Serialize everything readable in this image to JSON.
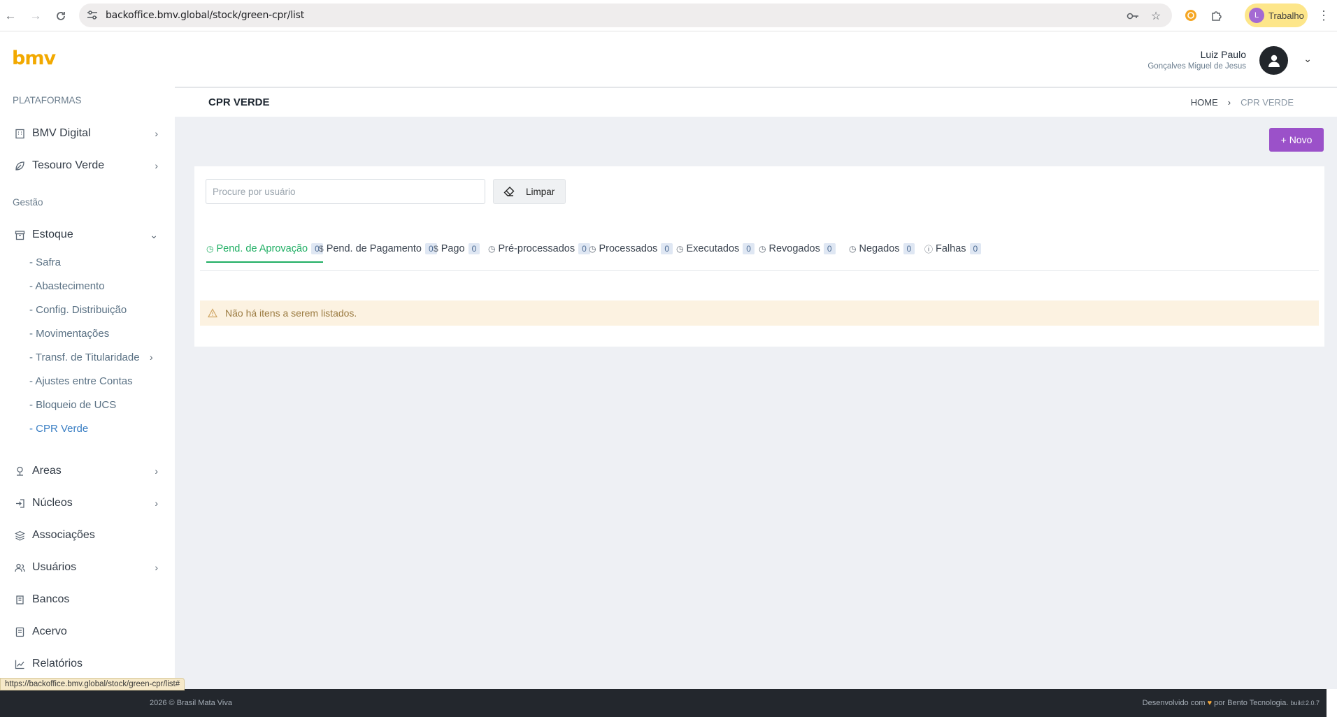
{
  "browser": {
    "url": "backoffice.bmv.global/stock/green-cpr/list",
    "profile_initial": "L",
    "profile_label": "Trabalho",
    "status_url": "https://backoffice.bmv.global/stock/green-cpr/list#"
  },
  "brand": {
    "logo_text": "bmv",
    "color": "#f2a900"
  },
  "sidebar": {
    "section_platforms": "PLATAFORMAS",
    "platforms": [
      {
        "label": "BMV Digital",
        "icon": "building-icon"
      },
      {
        "label": "Tesouro Verde",
        "icon": "leaf-icon"
      }
    ],
    "section_management": "Gestão",
    "stock": {
      "label": "Estoque",
      "icon": "archive-icon",
      "children": [
        {
          "label": "- Safra"
        },
        {
          "label": "- Abastecimento"
        },
        {
          "label": "- Config. Distribuição"
        },
        {
          "label": "- Movimentações"
        },
        {
          "label": "- Transf. de Titularidade"
        },
        {
          "label": "- Ajustes entre Contas"
        },
        {
          "label": "- Bloqueio de UCS"
        },
        {
          "label": "- CPR Verde"
        }
      ]
    },
    "items": [
      {
        "label": "Areas",
        "icon": "tree-icon"
      },
      {
        "label": "Núcleos",
        "icon": "login-icon"
      },
      {
        "label": "Associações",
        "icon": "layers-icon"
      },
      {
        "label": "Usuários",
        "icon": "users-icon"
      },
      {
        "label": "Bancos",
        "icon": "bank-icon"
      },
      {
        "label": "Acervo",
        "icon": "book-icon"
      },
      {
        "label": "Relatórios",
        "icon": "chart-icon"
      }
    ]
  },
  "user": {
    "name": "Luiz Paulo",
    "subtitle": "Gonçalves Miguel de Jesus"
  },
  "page": {
    "title": "CPR VERDE",
    "breadcrumb_home": "HOME",
    "breadcrumb_separator": "›",
    "breadcrumb_current": "CPR VERDE",
    "new_button": "+ Novo",
    "new_button_color": "#9b51c9"
  },
  "filters": {
    "search_placeholder": "Procure por usuário",
    "clear_button": "Limpar"
  },
  "tabs": [
    {
      "label": "Pend. de Aprovação",
      "count": "0",
      "icon": "clock-icon",
      "active": true
    },
    {
      "label": "Pend. de Pagamento",
      "count": "0",
      "icon": "dollar-icon"
    },
    {
      "label": "Pago",
      "count": "0",
      "icon": "dollar-icon"
    },
    {
      "label": "Pré-processados",
      "count": "0",
      "icon": "clock-icon"
    },
    {
      "label": "Processados",
      "count": "0",
      "icon": "clock-icon"
    },
    {
      "label": "Executados",
      "count": "0",
      "icon": "clock-icon"
    },
    {
      "label": "Revogados",
      "count": "0",
      "icon": "clock-icon"
    },
    {
      "label": "Negados",
      "count": "0",
      "icon": "clock-icon"
    },
    {
      "label": "Falhas",
      "count": "0",
      "icon": "alert-circle-icon"
    }
  ],
  "empty_message": "Não há itens a serem listados.",
  "footer": {
    "copyright": "2026 © Brasil Mata Viva",
    "developed_prefix": "Desenvolvido com",
    "heart": "♥",
    "developed_suffix": "por Bento Tecnologia.",
    "build": "build:2.0.7"
  },
  "colors": {
    "active_tab": "#1fae63",
    "active_link": "#3b7fc4",
    "footer_bg": "#23272d"
  }
}
